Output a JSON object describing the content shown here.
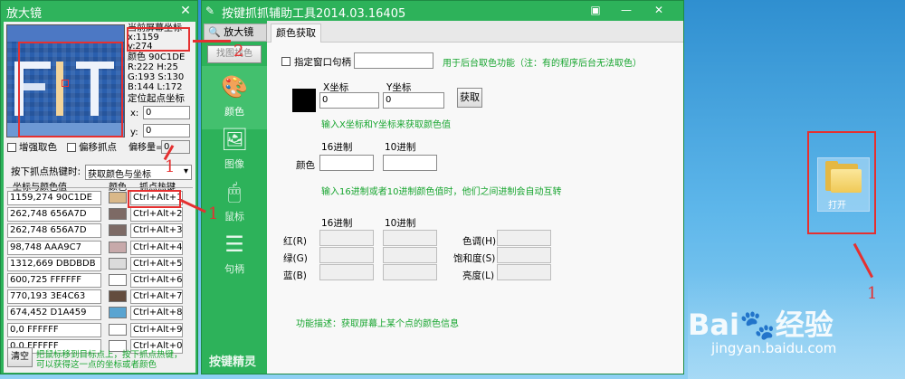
{
  "magnifier": {
    "title": "放大镜",
    "close": "✕",
    "screen_coord_label": "当前屏幕坐标",
    "x_coord": "x:1159",
    "y_coord": "y:274",
    "color_line": "颜色 90C1DE",
    "r_line": "R:222 H:25",
    "g_line": "G:193 S:130",
    "b_line": "B:144 L:172",
    "locate_label": "定位起点坐标",
    "x_label": "x:",
    "x_value": "0",
    "y_label": "y:",
    "y_value": "0",
    "enhance_label": "增强取色",
    "offset_label": "偏移抓点",
    "offset_value_label": "偏移量=",
    "offset_value": "0",
    "hotkey_label": "按下抓点热键时:",
    "hotkey_mode": "获取颜色与坐标",
    "table_headers": [
      "坐标与颜色值",
      "颜色",
      "抓点热键"
    ],
    "rows": [
      {
        "coord": "1159,274  90C1DE",
        "color": "#d9b889",
        "hotkey": "Ctrl+Alt+1"
      },
      {
        "coord": "262,748  656A7D",
        "color": "#7d6a65",
        "hotkey": "Ctrl+Alt+2"
      },
      {
        "coord": "262,748  656A7D",
        "color": "#7d6a65",
        "hotkey": "Ctrl+Alt+3"
      },
      {
        "coord": "98,748  AAA9C7",
        "color": "#c7a9aa",
        "hotkey": "Ctrl+Alt+4"
      },
      {
        "coord": "1312,669  DBDBDB",
        "color": "#dbdbdb",
        "hotkey": "Ctrl+Alt+5"
      },
      {
        "coord": "600,725  FFFFFF",
        "color": "#ffffff",
        "hotkey": "Ctrl+Alt+6"
      },
      {
        "coord": "770,193  3E4C63",
        "color": "#634c3e",
        "hotkey": "Ctrl+Alt+7"
      },
      {
        "coord": "674,452  D1A459",
        "color": "#59a4d1",
        "hotkey": "Ctrl+Alt+8"
      },
      {
        "coord": "0,0  FFFFFF",
        "color": "#ffffff",
        "hotkey": "Ctrl+Alt+9"
      },
      {
        "coord": "0,0  FFFFFF",
        "color": "#ffffff",
        "hotkey": "Ctrl+Alt+0"
      }
    ],
    "clear_button": "清空",
    "hint_line1": "把鼠标移到目标点上，按下抓点热键，",
    "hint_line2": "可以获得这一点的坐标或者颜色"
  },
  "tool": {
    "title": "按键抓抓辅助工具2014.03.16405",
    "controls": [
      "▣",
      "—",
      "✕"
    ],
    "side_top_tab": "放大镜",
    "side_find_button": "找图找色",
    "nav": [
      {
        "label": "颜色",
        "icon": "palette-icon",
        "glyph": "🎨"
      },
      {
        "label": "图像",
        "icon": "image-icon",
        "glyph": "🖼"
      },
      {
        "label": "鼠标",
        "icon": "mouse-icon",
        "glyph": "🖱"
      },
      {
        "label": "句柄",
        "icon": "sliders-icon",
        "glyph": "☰"
      }
    ],
    "brand": "按键精灵",
    "tab": "颜色获取",
    "handle_label": "指定窗口句柄",
    "handle_hint": "用于后台取色功能（注：有的程序后台无法取色）",
    "x_coord_label": "X坐标",
    "y_coord_label": "Y坐标",
    "x_value": "0",
    "y_value": "0",
    "get_button": "获取",
    "coord_hint": "输入X坐标和Y坐标来获取颜色值",
    "hex_label": "16进制",
    "dec_label": "10进制",
    "color_label": "颜色",
    "convert_hint": "输入16进制或者10进制颜色值时，他们之间进制会自动互转",
    "red_label": "红(R)",
    "green_label": "绿(G)",
    "blue_label": "蓝(B)",
    "hue_label": "色调(H)",
    "sat_label": "饱和度(S)",
    "lum_label": "亮度(L)",
    "description": "功能描述：获取屏幕上某个点的颜色信息",
    "preview_color": "#000000"
  },
  "desktop": {
    "folder_label": "打开"
  },
  "annotations": {
    "one": "1",
    "two": "2",
    "accent": "#e53030"
  },
  "watermark": {
    "brand": "Bai",
    "brand2": "经验",
    "url": "jingyan.baidu.com"
  }
}
